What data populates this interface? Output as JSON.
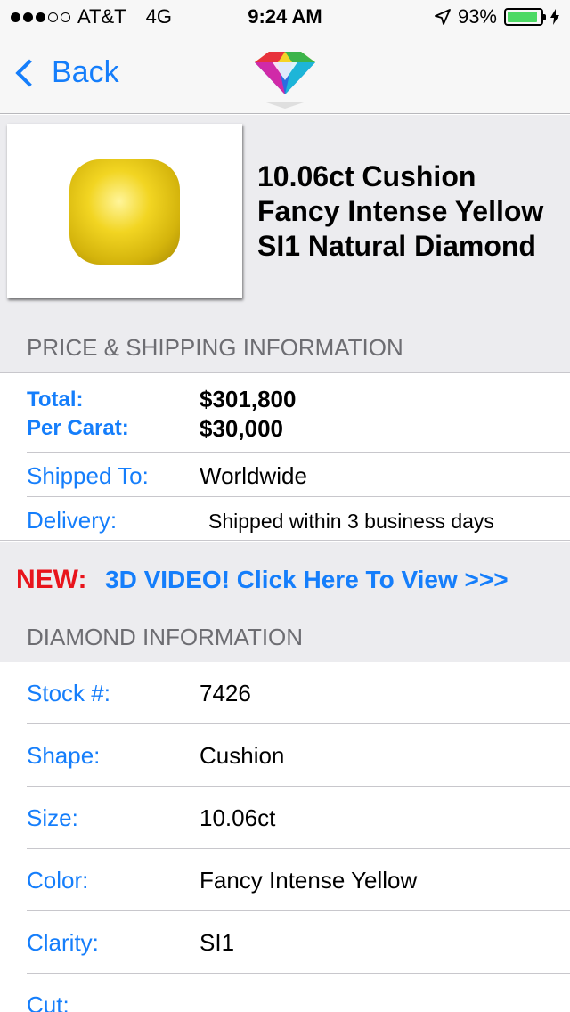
{
  "status_bar": {
    "carrier": "AT&T",
    "network": "4G",
    "time": "9:24 AM",
    "battery": "93%",
    "battery_level": 0.93,
    "signal_bars_filled": 3,
    "signal_bars_total": 5
  },
  "nav": {
    "back_label": "Back",
    "logo_icon": "diamond-logo-icon"
  },
  "product": {
    "title": "10.06ct Cushion Fancy Intense Yellow SI1 Natural Diamond",
    "image_icon": "yellow-cushion-diamond-image"
  },
  "price_section": {
    "header": "PRICE & SHIPPING INFORMATION",
    "total_label": "Total:",
    "total_value": "$301,800",
    "per_carat_label": "Per Carat:",
    "per_carat_value": "$30,000",
    "shipped_to_label": "Shipped To:",
    "shipped_to_value": "Worldwide",
    "delivery_label": "Delivery:",
    "delivery_value": "Shipped within 3 business days"
  },
  "banner": {
    "new_label": "NEW:",
    "video_link": "3D VIDEO! Click Here To View >>>"
  },
  "diamond_section": {
    "header": "DIAMOND INFORMATION",
    "rows": [
      {
        "label": "Stock #:",
        "value": "7426"
      },
      {
        "label": "Shape:",
        "value": "Cushion"
      },
      {
        "label": "Size:",
        "value": "10.06ct"
      },
      {
        "label": "Color:",
        "value": "Fancy Intense Yellow"
      },
      {
        "label": "Clarity:",
        "value": "SI1"
      },
      {
        "label": "Cut:",
        "value": ""
      }
    ]
  },
  "colors": {
    "accent_blue": "#157efb",
    "new_red": "#e8141c",
    "section_gray": "#ececef",
    "battery_green": "#4cd964"
  }
}
